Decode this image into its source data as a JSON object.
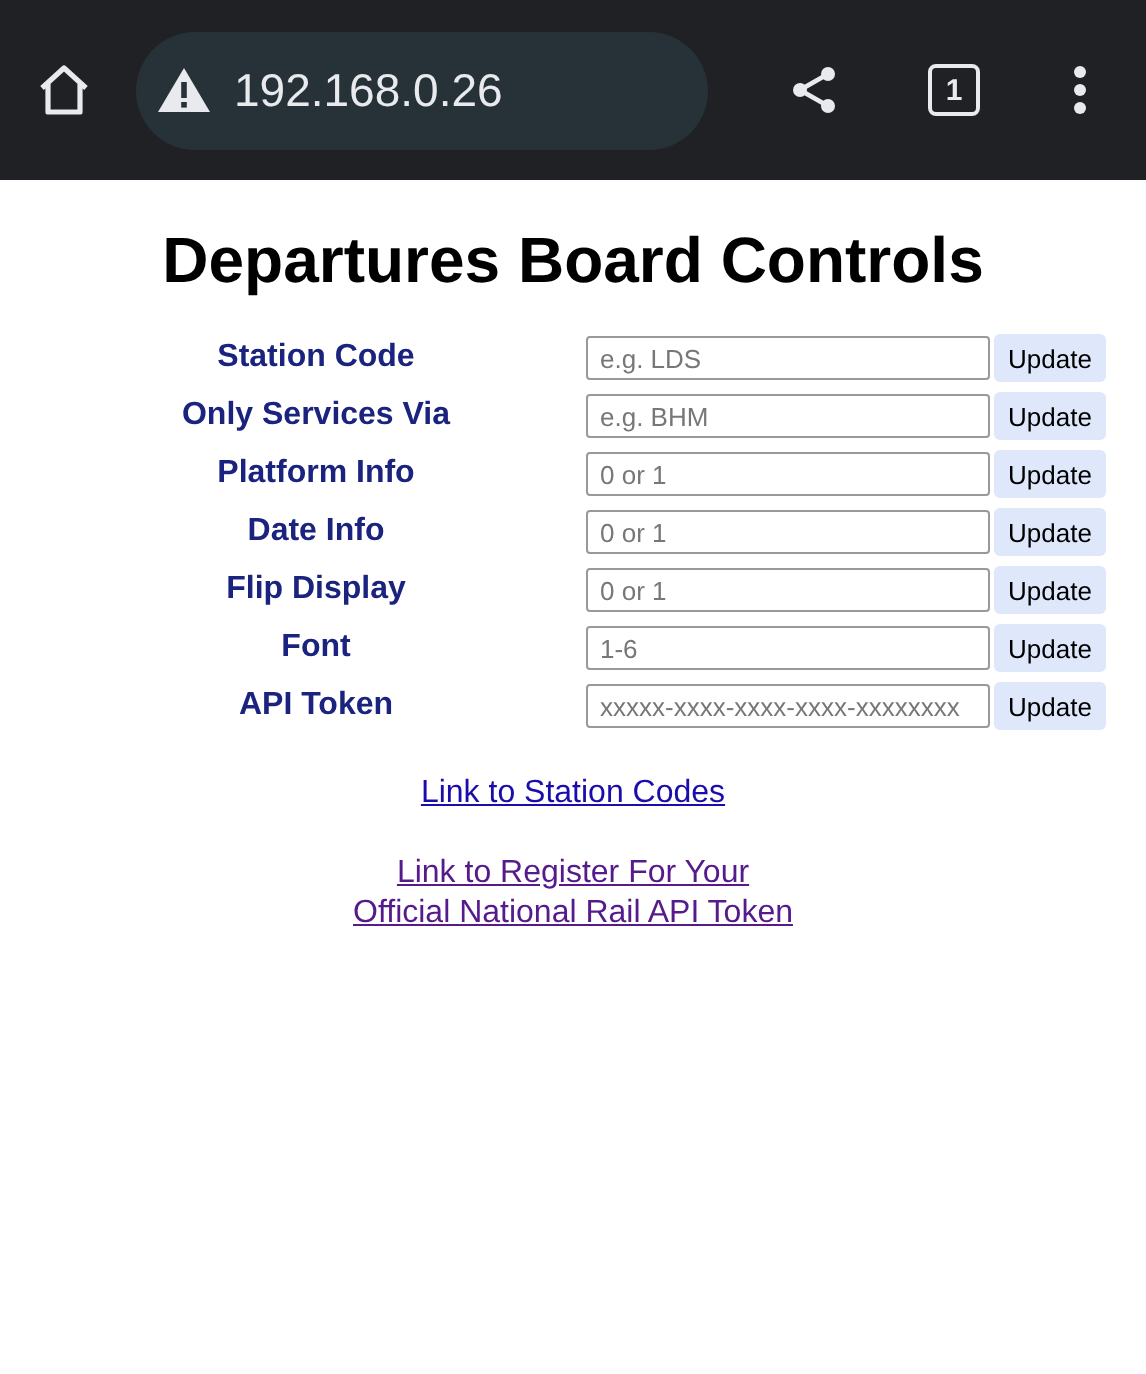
{
  "browser": {
    "url": "192.168.0.26",
    "insecure": true,
    "tab_count": "1"
  },
  "title": "Departures Board Controls",
  "settings": [
    {
      "label": "Station Code",
      "placeholder": "e.g. LDS",
      "button": "Update"
    },
    {
      "label": "Only Services Via",
      "placeholder": "e.g. BHM",
      "button": "Update"
    },
    {
      "label": "Platform Info",
      "placeholder": "0 or 1",
      "button": "Update"
    },
    {
      "label": "Date Info",
      "placeholder": "0 or 1",
      "button": "Update"
    },
    {
      "label": "Flip Display",
      "placeholder": "0 or 1",
      "button": "Update"
    },
    {
      "label": "Font",
      "placeholder": "1-6",
      "button": "Update"
    },
    {
      "label": "API Token",
      "placeholder": "xxxxx-xxxx-xxxx-xxxx-xxxxxxxx",
      "button": "Update"
    }
  ],
  "links": [
    {
      "lines": [
        "Link to Station Codes"
      ],
      "visited": false
    },
    {
      "lines": [
        "Link to Register For Your",
        "Official National Rail API Token"
      ],
      "visited": true
    }
  ]
}
